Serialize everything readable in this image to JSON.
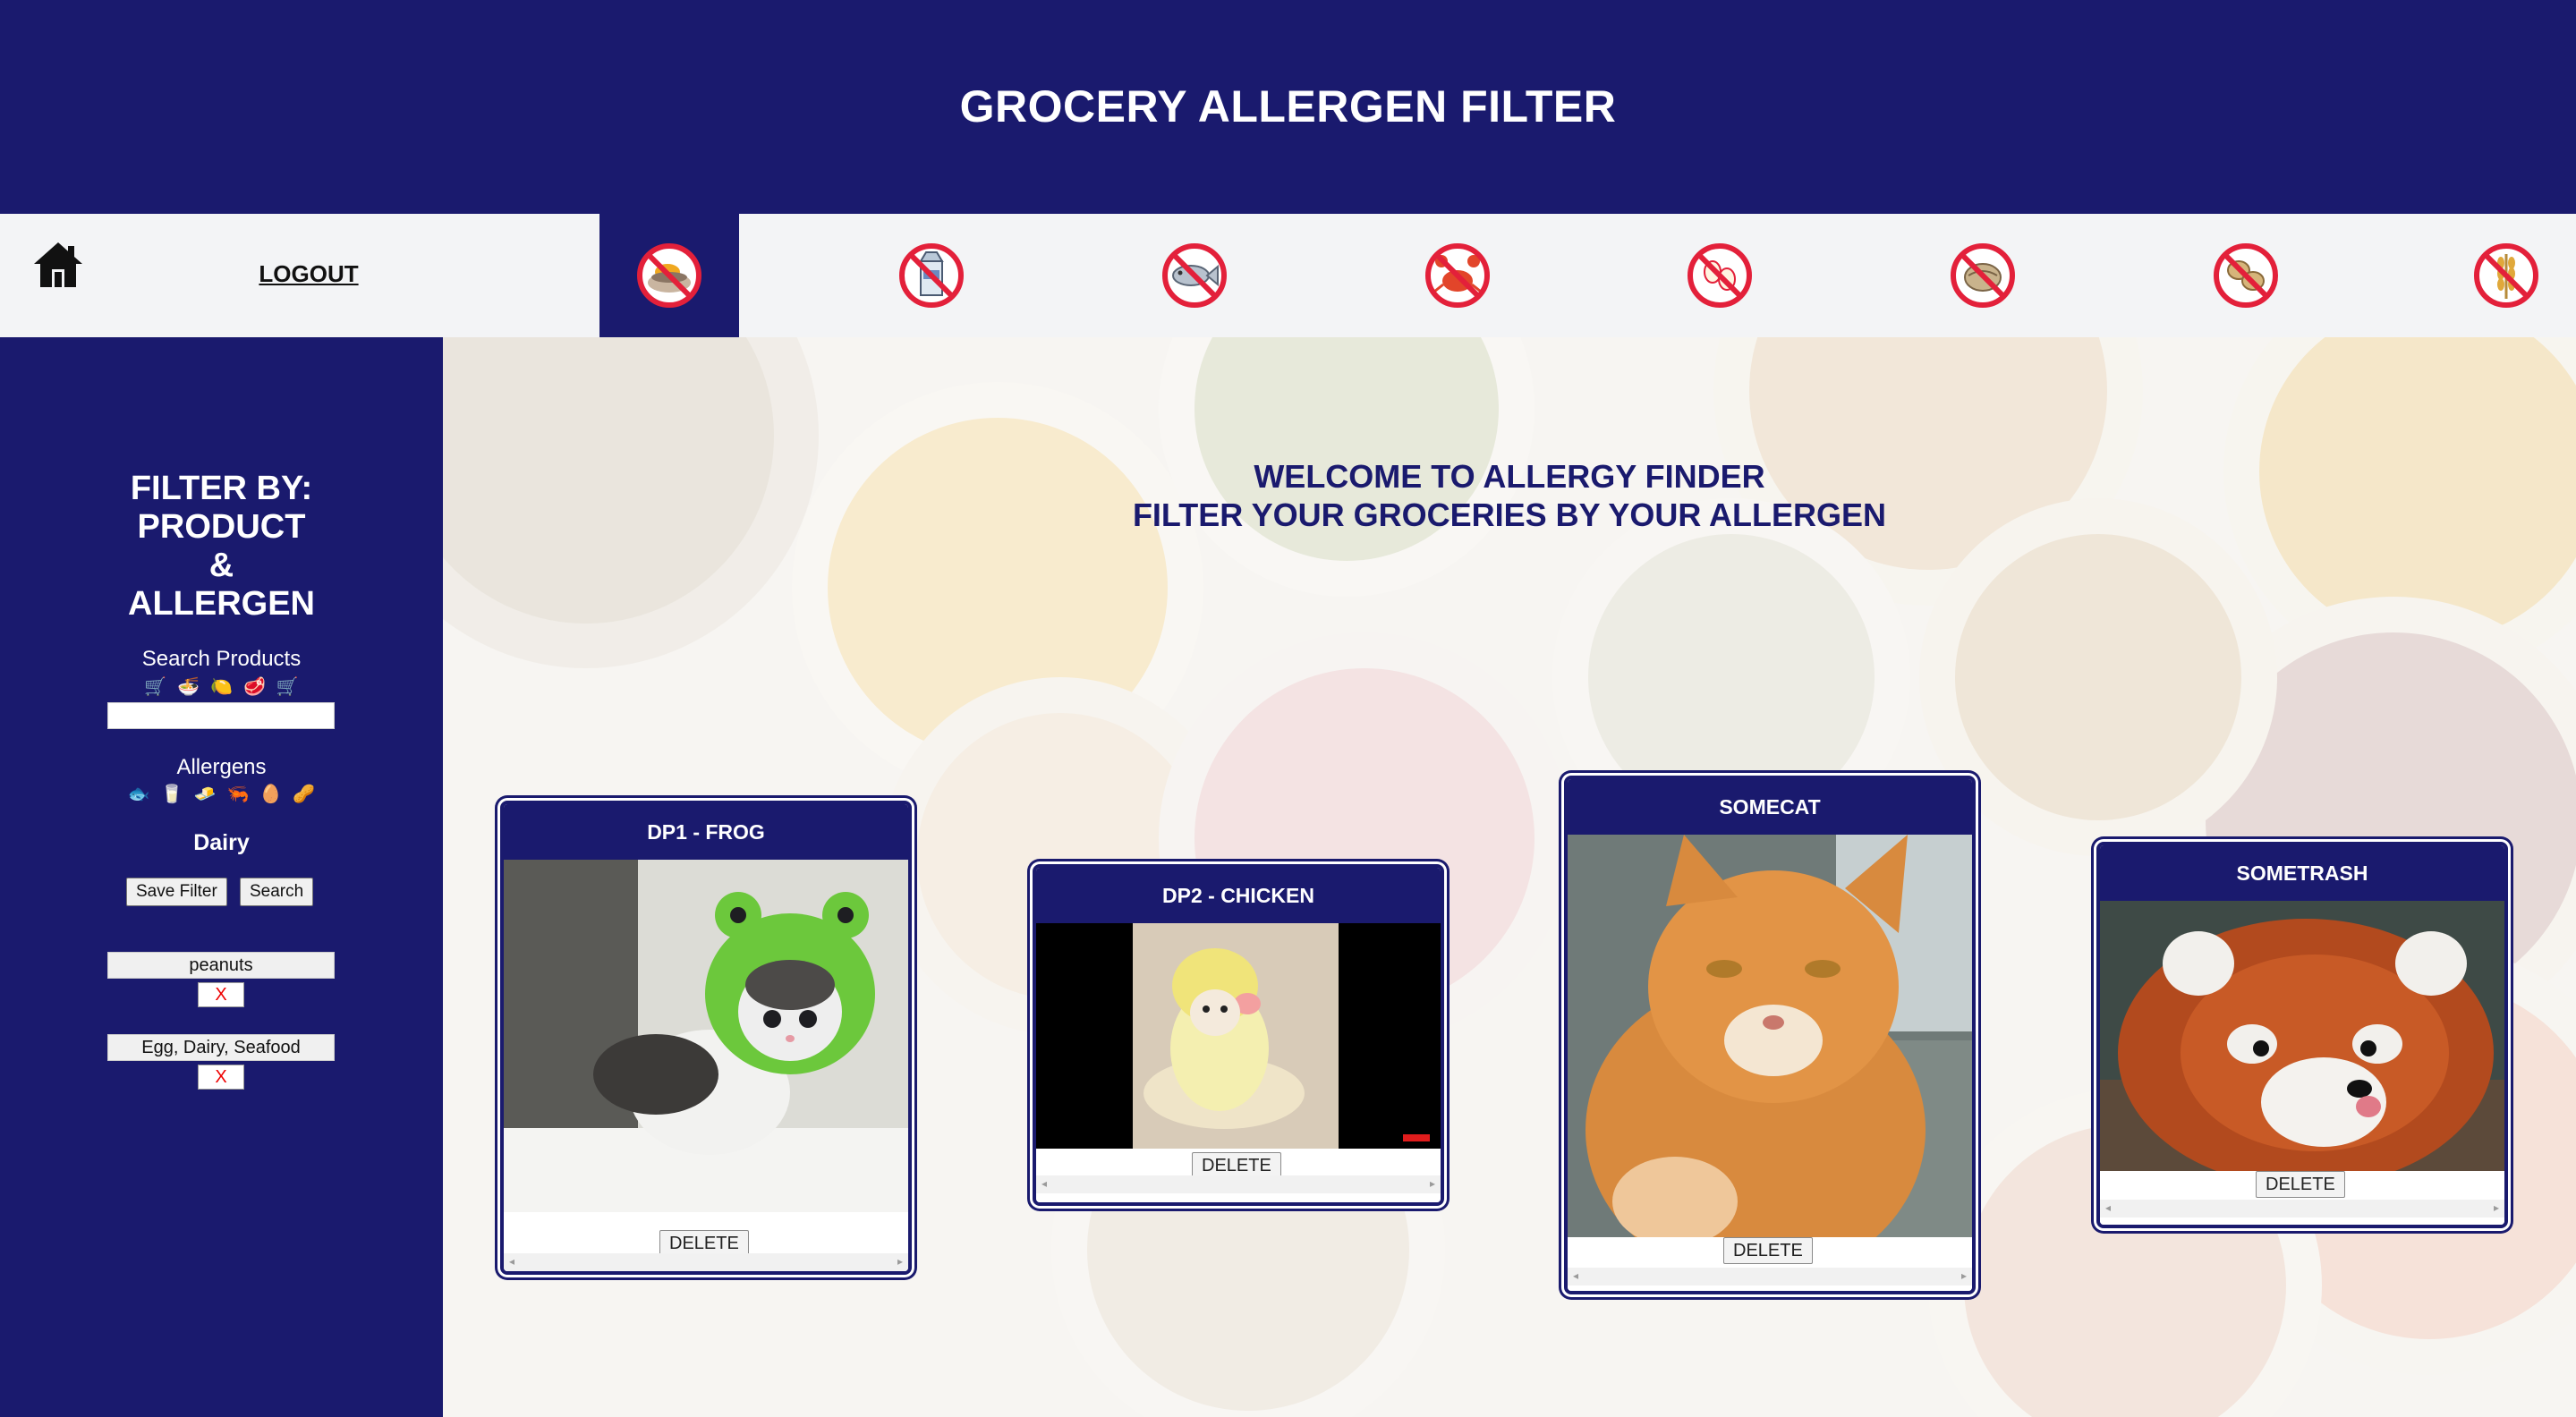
{
  "header": {
    "title": "GROCERY ALLERGEN FILTER"
  },
  "nav": {
    "home_icon": "home-icon",
    "logout_label": "LOGOUT",
    "allergens": [
      {
        "icon": "no-shellfish-icon",
        "active": true
      },
      {
        "icon": "no-milk-icon",
        "active": false
      },
      {
        "icon": "no-fish-icon",
        "active": false
      },
      {
        "icon": "no-crab-icon",
        "active": false
      },
      {
        "icon": "no-egg-icon",
        "active": false
      },
      {
        "icon": "no-tree-nut-icon",
        "active": false
      },
      {
        "icon": "no-peanut-icon",
        "active": false
      },
      {
        "icon": "no-wheat-icon",
        "active": false
      }
    ]
  },
  "sidebar": {
    "title_lines": [
      "FILTER BY:",
      "PRODUCT",
      "&",
      "ALLERGEN"
    ],
    "search_label": "Search Products",
    "search_emojis": [
      "🛒",
      "🍜",
      "🍋",
      "🥩",
      "🛒"
    ],
    "search_value": "",
    "allergens_label": "Allergens",
    "allergen_emojis": [
      "🐟",
      "🥛",
      "🧈",
      "🦐",
      "🥚",
      "🥜"
    ],
    "selected_allergen": "Dairy",
    "save_filter_label": "Save Filter",
    "search_button_label": "Search",
    "saved_filters": [
      {
        "text": "peanuts",
        "remove_label": "X"
      },
      {
        "text": "Egg, Dairy, Seafood",
        "remove_label": "X"
      }
    ]
  },
  "main": {
    "welcome_line1": "WELCOME TO ALLERGY FINDER",
    "welcome_line2": "FILTER YOUR GROCERIES BY YOUR ALLERGEN",
    "cards": [
      {
        "title": "DP1 - FROG",
        "image": "kitten-in-frog-hat",
        "delete_label": "DELETE"
      },
      {
        "title": "DP2 - CHICKEN",
        "image": "dog-in-chick-costume",
        "delete_label": "DELETE"
      },
      {
        "title": "SOMECAT",
        "image": "orange-tabby-cat",
        "delete_label": "DELETE"
      },
      {
        "title": "SOMETRASH",
        "image": "red-panda",
        "delete_label": "DELETE"
      }
    ]
  },
  "colors": {
    "navy": "#1a1a6e",
    "nav_bg": "#f3f4f6",
    "prohibit_red": "#e3203a"
  }
}
